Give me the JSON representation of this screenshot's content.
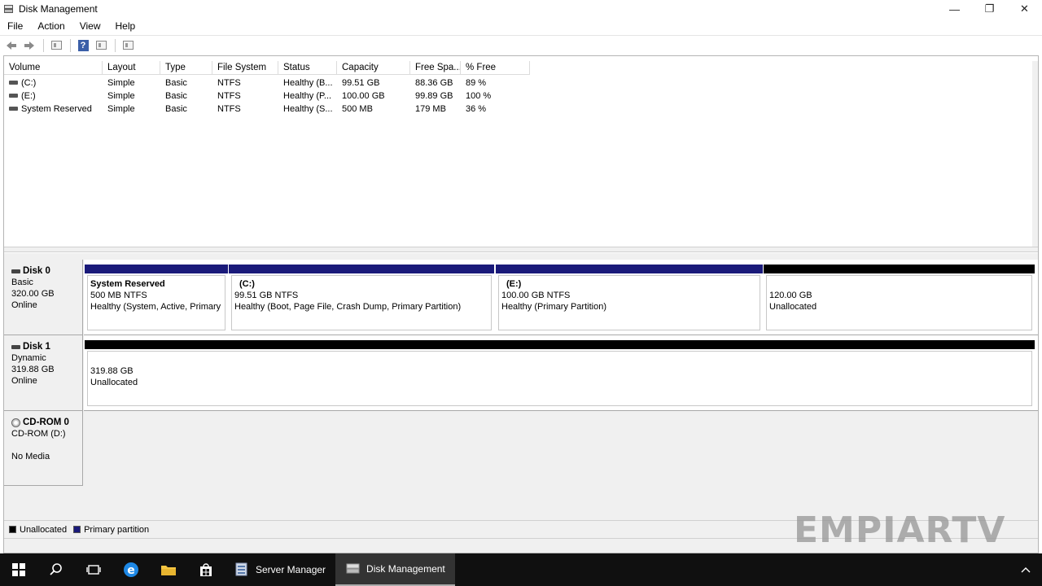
{
  "window": {
    "title": "Disk Management",
    "minimize": "—",
    "restore": "❐",
    "close": "✕"
  },
  "menu": [
    "File",
    "Action",
    "View",
    "Help"
  ],
  "volume_list": {
    "columns": [
      "Volume",
      "Layout",
      "Type",
      "File System",
      "Status",
      "Capacity",
      "Free Spa...",
      "% Free"
    ],
    "rows": [
      {
        "volume": "(C:)",
        "layout": "Simple",
        "type": "Basic",
        "fs": "NTFS",
        "status": "Healthy (B...",
        "capacity": "99.51 GB",
        "free": "88.36 GB",
        "pct": "89 %"
      },
      {
        "volume": "(E:)",
        "layout": "Simple",
        "type": "Basic",
        "fs": "NTFS",
        "status": "Healthy (P...",
        "capacity": "100.00 GB",
        "free": "99.89 GB",
        "pct": "100 %"
      },
      {
        "volume": "System Reserved",
        "layout": "Simple",
        "type": "Basic",
        "fs": "NTFS",
        "status": "Healthy (S...",
        "capacity": "500 MB",
        "free": "179 MB",
        "pct": "36 %"
      }
    ]
  },
  "disks": {
    "disk0": {
      "name": "Disk 0",
      "type": "Basic",
      "size": "320.00 GB",
      "state": "Online",
      "partitions": {
        "sysres": {
          "title": "System Reserved",
          "size": "500 MB NTFS",
          "status": "Healthy (System, Active, Primary"
        },
        "c": {
          "title": "(C:)",
          "size": "99.51 GB NTFS",
          "status": "Healthy (Boot, Page File, Crash Dump, Primary Partition)"
        },
        "e": {
          "title": "(E:)",
          "size": "100.00 GB NTFS",
          "status": "Healthy (Primary Partition)"
        },
        "unalloc": {
          "size": "120.00 GB",
          "status": "Unallocated"
        }
      }
    },
    "disk1": {
      "name": "Disk 1",
      "type": "Dynamic",
      "size": "319.88 GB",
      "state": "Online",
      "partitions": {
        "unalloc": {
          "size": "319.88 GB",
          "status": "Unallocated"
        }
      }
    },
    "cdrom0": {
      "name": "CD-ROM 0",
      "drive": "CD-ROM (D:)",
      "state": "No Media"
    }
  },
  "legend": {
    "unallocated": "Unallocated",
    "primary": "Primary partition"
  },
  "colors": {
    "primary": "#1a1a7a",
    "unallocated": "#000000"
  },
  "watermark": "EMPIARTV",
  "taskbar": {
    "apps": [
      "Server Manager",
      "Disk Management"
    ]
  }
}
